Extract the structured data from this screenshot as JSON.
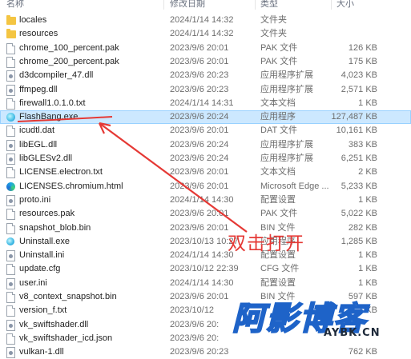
{
  "columns": {
    "name": "名称",
    "date": "修改日期",
    "type": "类型",
    "size": "大小"
  },
  "files": [
    {
      "name": "locales",
      "date": "2024/1/14 14:32",
      "type": "文件夹",
      "size": "",
      "icon": "folder-icon"
    },
    {
      "name": "resources",
      "date": "2024/1/14 14:32",
      "type": "文件夹",
      "size": "",
      "icon": "folder-icon"
    },
    {
      "name": "chrome_100_percent.pak",
      "date": "2023/9/6 20:01",
      "type": "PAK 文件",
      "size": "126 KB",
      "icon": "file-icon"
    },
    {
      "name": "chrome_200_percent.pak",
      "date": "2023/9/6 20:01",
      "type": "PAK 文件",
      "size": "175 KB",
      "icon": "file-icon"
    },
    {
      "name": "d3dcompiler_47.dll",
      "date": "2023/9/6 20:23",
      "type": "应用程序扩展",
      "size": "4,023 KB",
      "icon": "dll-icon"
    },
    {
      "name": "ffmpeg.dll",
      "date": "2023/9/6 20:23",
      "type": "应用程序扩展",
      "size": "2,571 KB",
      "icon": "dll-icon"
    },
    {
      "name": "firewall1.0.1.0.txt",
      "date": "2024/1/14 14:31",
      "type": "文本文档",
      "size": "1 KB",
      "icon": "file-icon"
    },
    {
      "name": "FlashBang.exe",
      "date": "2023/9/6 20:24",
      "type": "应用程序",
      "size": "127,487 KB",
      "icon": "app-icon"
    },
    {
      "name": "icudtl.dat",
      "date": "2023/9/6 20:01",
      "type": "DAT 文件",
      "size": "10,161 KB",
      "icon": "file-icon"
    },
    {
      "name": "libEGL.dll",
      "date": "2023/9/6 20:24",
      "type": "应用程序扩展",
      "size": "383 KB",
      "icon": "dll-icon"
    },
    {
      "name": "libGLESv2.dll",
      "date": "2023/9/6 20:24",
      "type": "应用程序扩展",
      "size": "6,251 KB",
      "icon": "dll-icon"
    },
    {
      "name": "LICENSE.electron.txt",
      "date": "2023/9/6 20:01",
      "type": "文本文档",
      "size": "2 KB",
      "icon": "file-icon"
    },
    {
      "name": "LICENSES.chromium.html",
      "date": "2023/9/6 20:01",
      "type": "Microsoft Edge ...",
      "size": "5,233 KB",
      "icon": "edge-icon"
    },
    {
      "name": "proto.ini",
      "date": "2024/1/14 14:30",
      "type": "配置设置",
      "size": "1 KB",
      "icon": "config-icon"
    },
    {
      "name": "resources.pak",
      "date": "2023/9/6 20:01",
      "type": "PAK 文件",
      "size": "5,022 KB",
      "icon": "file-icon"
    },
    {
      "name": "snapshot_blob.bin",
      "date": "2023/9/6 20:01",
      "type": "BIN 文件",
      "size": "282 KB",
      "icon": "file-icon"
    },
    {
      "name": "Uninstall.exe",
      "date": "2023/10/13 10:27",
      "type": "应用程序",
      "size": "1,285 KB",
      "icon": "uninstall-icon"
    },
    {
      "name": "Uninstall.ini",
      "date": "2024/1/14 14:30",
      "type": "配置设置",
      "size": "1 KB",
      "icon": "config-icon"
    },
    {
      "name": "update.cfg",
      "date": "2023/10/12 22:39",
      "type": "CFG 文件",
      "size": "1 KB",
      "icon": "file-icon"
    },
    {
      "name": "user.ini",
      "date": "2024/1/14 14:30",
      "type": "配置设置",
      "size": "1 KB",
      "icon": "config-icon"
    },
    {
      "name": "v8_context_snapshot.bin",
      "date": "2023/9/6 20:01",
      "type": "BIN 文件",
      "size": "597 KB",
      "icon": "file-icon"
    },
    {
      "name": "version_f.txt",
      "date": "2023/10/12",
      "type": "",
      "size": "1 KB",
      "icon": "file-icon"
    },
    {
      "name": "vk_swiftshader.dll",
      "date": "2023/9/6 20:",
      "type": "",
      "size": "",
      "icon": "dll-icon"
    },
    {
      "name": "vk_swiftshader_icd.json",
      "date": "2023/9/6 20:",
      "type": "",
      "size": "",
      "icon": "file-icon"
    },
    {
      "name": "vulkan-1.dll",
      "date": "2023/9/6 20:23",
      "type": "",
      "size": "762 KB",
      "icon": "dll-icon"
    }
  ],
  "selected_index": 7,
  "annotation": {
    "text": "双击打开",
    "color": "#e53935"
  },
  "watermark": {
    "text": "阿影博客",
    "subtext": "AYBK.CN",
    "color": "#1e63c8"
  },
  "colors": {
    "selection": "#cce8ff",
    "selection_border": "#99d1ff",
    "folder": "#f4c542"
  }
}
